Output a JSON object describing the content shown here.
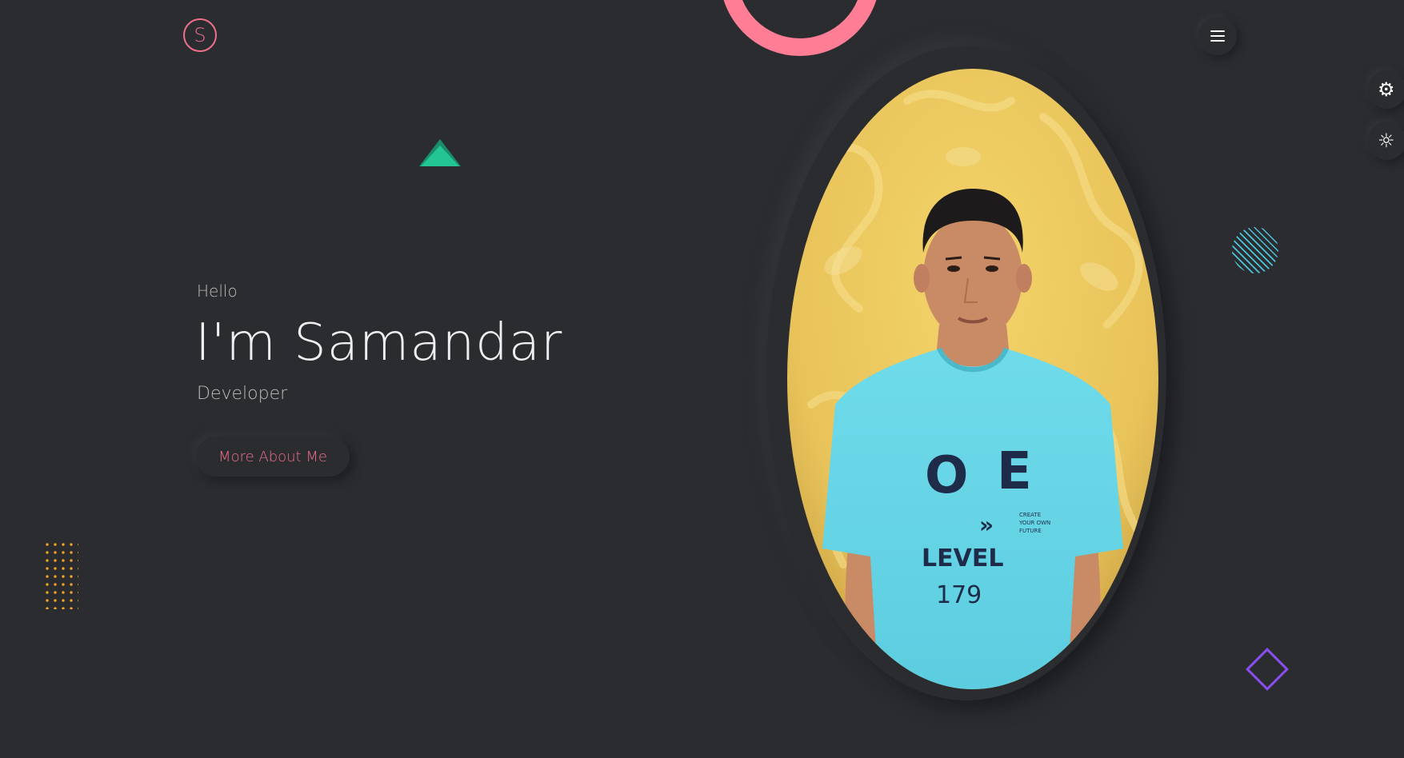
{
  "header": {
    "logo_letter": "S",
    "menu_icon": "hamburger-icon"
  },
  "side_tools": [
    {
      "icon": "settings-gear-icon"
    },
    {
      "icon": "sun-theme-icon"
    }
  ],
  "hero": {
    "greeting": "Hello",
    "name": "I'm Samandar",
    "role": "Developer",
    "button_label": "More About Me"
  },
  "portrait": {
    "alt": "Portrait photo",
    "shirt_text": {
      "o": "O",
      "e": "E",
      "level": "LEVEL",
      "number": "179",
      "create": "CREATE",
      "your_own": "YOUR OWN",
      "future": "FUTURE"
    }
  },
  "colors": {
    "background": "#2b2c30",
    "accent_pink": "#f06f8b",
    "ring_pink": "#ff7e95",
    "green": "#1fbf8f",
    "orange": "#f4a422",
    "cyan": "#4fc3d9",
    "purple": "#8b4cf0"
  }
}
